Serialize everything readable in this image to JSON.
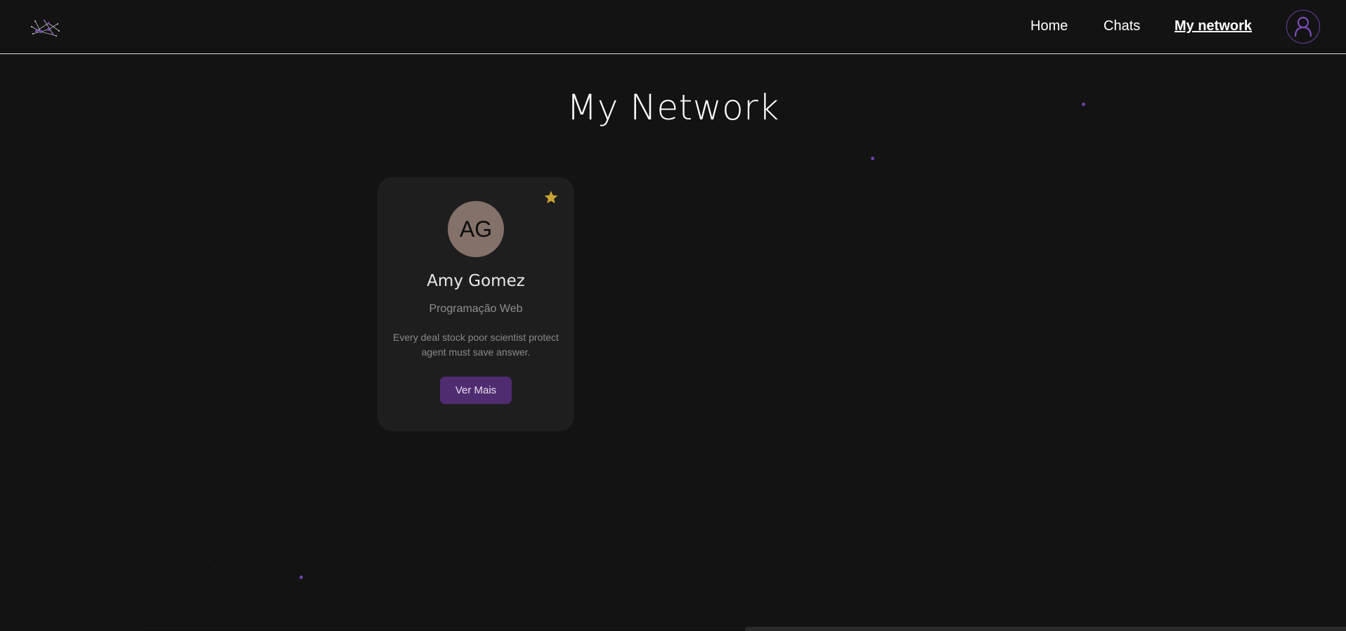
{
  "nav": {
    "links": [
      "Home",
      "Chats",
      "My network"
    ],
    "active": "My network"
  },
  "page": {
    "title": "My Network"
  },
  "card": {
    "initials": "AG",
    "name": "Amy Gomez",
    "role": "Programação Web",
    "description": "Every deal stock poor scientist protect agent must save answer.",
    "button_label": "Ver Mais",
    "favorite": true
  },
  "colors": {
    "background": "#131313",
    "card": "#1e1e1e",
    "accent": "#6b3fa6",
    "button": "#4f2b70",
    "star": "#c9a233",
    "avatar": "#84716a"
  },
  "icons": [
    "network-logo-icon",
    "user-icon",
    "star-icon"
  ]
}
